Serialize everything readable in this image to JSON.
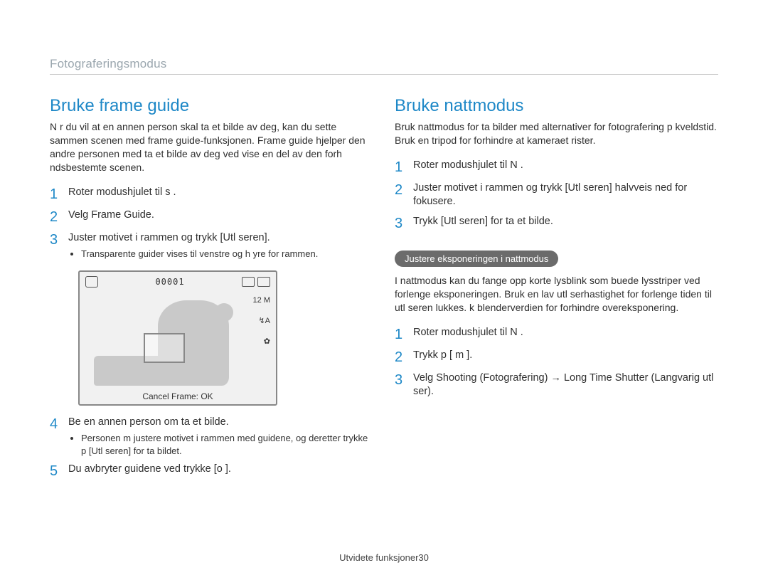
{
  "header": {
    "breadcrumb": "Fotograferingsmodus"
  },
  "left": {
    "title": "Bruke frame guide",
    "lead": "N r du vil at en annen person skal ta et bilde av deg, kan du sette sammen scenen med frame guide-funksjonen. Frame guide hjelper den andre personen med   ta et bilde av deg ved   vise en del av den forh ndsbestemte scenen.",
    "step1": "Roter modushjulet til s    .",
    "step2": "Velg Frame Guide.",
    "step3": "Juster motivet i rammen og trykk [Utl seren].",
    "step3_sub": "Transparente guider vises til venstre og h yre for rammen.",
    "lcd": {
      "counter": "00001",
      "label_12m": "12 M",
      "label_flash": "↯A",
      "label_macro": "✿",
      "bottom": "Cancel Frame: OK"
    },
    "step4": "Be en annen person om   ta et bilde.",
    "step4_sub": "Personen m  justere motivet i rammen med guidene, og deretter trykke p  [Utl seren] for   ta bildet.",
    "step5": "Du avbryter guidene ved   trykke [o   ]."
  },
  "right": {
    "title": "Bruke nattmodus",
    "lead": "Bruk nattmodus for   ta bilder med alternativer for fotografering p  kveldstid. Bruk en tripod for   forhindre at kameraet rister.",
    "step1": "Roter modushjulet til N   .",
    "step2": "Juster motivet i rammen og trykk [Utl seren] halvveis ned for   fokusere.",
    "step3": "Trykk [Utl seren] for   ta et bilde.",
    "pill": "Justere eksponeringen i nattmodus",
    "expo_lead": "I nattmodus kan du fange opp korte lysblink som buede lysstriper ved   forlenge eksponeringen. Bruk en lav utl serhastighet for   forlenge tiden til utl seren lukkes.  k blenderverdien for   forhindre overeksponering.",
    "estep1": "Roter modushjulet til N   .",
    "estep2": "Trykk p  [ m     ].",
    "estep3": "Velg Shooting (Fotografering) → Long Time Shutter (Langvarig utl ser)."
  },
  "footer": {
    "label": "Utvidete funksjoner",
    "page": "30"
  }
}
